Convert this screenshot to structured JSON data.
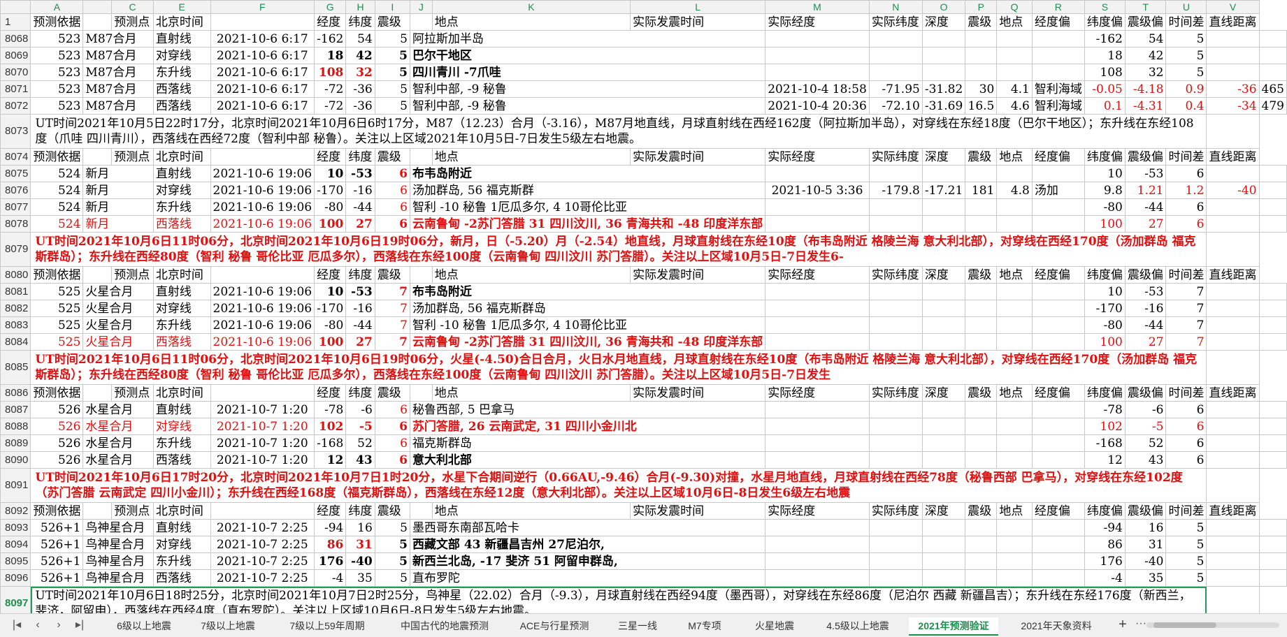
{
  "columns": [
    "",
    "A",
    "",
    "C",
    "E",
    "F",
    "G",
    "H",
    "I",
    "J",
    "K",
    "L",
    "M",
    "N",
    "O",
    "P",
    "Q",
    "R",
    "S",
    "T",
    "U",
    "V"
  ],
  "header_labels": [
    "预测序",
    "预测依据",
    "预测点",
    "北京时间",
    "经度",
    "纬度",
    "震级",
    "地点",
    "实际发震时间",
    "实际经度",
    "实际纬度",
    "深度",
    "震级",
    "地点",
    "经度偏",
    "纬度偏",
    "震级偏",
    "时间差",
    "直线距离"
  ],
  "rows": {
    "r8068": {
      "n": "8068",
      "seq": "523",
      "basis": "M87合月",
      "point": "直射线",
      "time": "2021-10-6 6:17",
      "lon": "-162",
      "lat": "54",
      "mag": "5",
      "place": "阿拉斯加半岛",
      "dlon": "-162",
      "dlat": "54",
      "dmag": "5"
    },
    "r8069": {
      "n": "8069",
      "seq": "523",
      "basis": "M87合月",
      "point": "对穿线",
      "time": "2021-10-6 6:17",
      "lon": "18",
      "lat": "42",
      "mag": "5",
      "place": "巴尔干地区",
      "dlon": "18",
      "dlat": "42",
      "dmag": "5"
    },
    "r8070": {
      "n": "8070",
      "seq": "523",
      "basis": "M87合月",
      "point": "东升线",
      "time": "2021-10-6 6:17",
      "lon": "108",
      "lat": "32",
      "mag": "5",
      "place": "四川青川 -7爪哇",
      "dlon": "108",
      "dlat": "32",
      "dmag": "5"
    },
    "r8071": {
      "n": "8071",
      "seq": "523",
      "basis": "M87合月",
      "point": "西落线",
      "time": "2021-10-6 6:17",
      "lon": "-72",
      "lat": "-36",
      "mag": "5",
      "place": "智利中部, -9 秘鲁",
      "atime": "2021-10-4 18:58",
      "alon": "-71.95",
      "alat": "-31.82",
      "depth": "30",
      "amag": "4.1",
      "aplace": "智利海域",
      "dlon": "-0.05",
      "dlat": "-4.18",
      "dmag": "0.9",
      "dt": "-36",
      "dist": "465"
    },
    "r8072": {
      "n": "8072",
      "seq": "523",
      "basis": "M87合月",
      "point": "西落线",
      "time": "2021-10-6 6:17",
      "lon": "-72",
      "lat": "-36",
      "mag": "5",
      "place": "智利中部, -9 秘鲁",
      "atime": "2021-10-4 20:36",
      "alon": "-72.10",
      "alat": "-31.69",
      "depth": "16.5",
      "amag": "4.6",
      "aplace": "智利海域",
      "dlon": "0.1",
      "dlat": "-4.31",
      "dmag": "0.4",
      "dt": "-34",
      "dist": "479"
    },
    "n8073": {
      "n": "8073",
      "text": "UT时间2021年10月5日22时17分，北京时间2021年10月6日6时17分，M87（12.23）合月（-3.16），M87月地直线，月球直射线在西经162度（阿拉斯加半岛），对穿线在东经18度（巴尔干地区）；东升线在东经108度（爪哇 四川青川），西落线在西经72度（智利中部 秘鲁）。关注以上区域2021年10月5日-7日发生5级左右地震。"
    },
    "h8074": {
      "n": "8074"
    },
    "r8075": {
      "n": "8075",
      "seq": "524",
      "basis": "新月",
      "point": "直射线",
      "time": "2021-10-6 19:06",
      "lon": "10",
      "lat": "-53",
      "mag": "6",
      "place": "布韦岛附近",
      "dlon": "10",
      "dlat": "-53",
      "dmag": "6"
    },
    "r8076": {
      "n": "8076",
      "seq": "524",
      "basis": "新月",
      "point": "对穿线",
      "time": "2021-10-6 19:06",
      "lon": "-170",
      "lat": "-16",
      "mag": "6",
      "place": "汤加群岛, 56 福克斯群",
      "atime": "2021-10-5 3:36",
      "alon": "-179.8",
      "alat": "-17.21",
      "depth": "181",
      "amag": "4.8",
      "aplace": "汤加",
      "dlon": "9.8",
      "dlat": "1.21",
      "dmag": "1.2",
      "dt": "-40"
    },
    "r8077": {
      "n": "8077",
      "seq": "524",
      "basis": "新月",
      "point": "东升线",
      "time": "2021-10-6 19:06",
      "lon": "-80",
      "lat": "-44",
      "mag": "6",
      "place": "智利 -10 秘鲁 1厄瓜多尔, 4 10哥伦比亚",
      "dlon": "-80",
      "dlat": "-44",
      "dmag": "6"
    },
    "r8078": {
      "n": "8078",
      "seq": "524",
      "basis": "新月",
      "point": "西落线",
      "time": "2021-10-6 19:06",
      "lon": "100",
      "lat": "27",
      "mag": "6",
      "place": "云南鲁甸 -2苏门答腊  31 四川汶川,  36 青海共和 -48 印度洋东部",
      "dlon": "100",
      "dlat": "27",
      "dmag": "6"
    },
    "n8079": {
      "n": "8079",
      "text": "UT时间2021年10月6日11时06分，北京时间2021年10月6日19时06分，新月，日（-5.20）月（-2.54）地直线，月球直射线在东经10度（布韦岛附近 格陵兰海 意大利北部），对穿线在西经170度（汤加群岛 福克斯群岛）；东升线在西经80度（智利 秘鲁 哥伦比亚 厄瓜多尔），西落线在东经100度（云南鲁甸 四川汶川 苏门答腊）。关注以上区域10月5日-7日发生6-"
    },
    "h8080": {
      "n": "8080"
    },
    "r8081": {
      "n": "8081",
      "seq": "525",
      "basis": "火星合月",
      "point": "直射线",
      "time": "2021-10-6 19:06",
      "lon": "10",
      "lat": "-53",
      "mag": "7",
      "place": "布韦岛附近",
      "dlon": "10",
      "dlat": "-53",
      "dmag": "7"
    },
    "r8082": {
      "n": "8082",
      "seq": "525",
      "basis": "火星合月",
      "point": "对穿线",
      "time": "2021-10-6 19:06",
      "lon": "-170",
      "lat": "-16",
      "mag": "7",
      "place": "汤加群岛, 56 福克斯群岛",
      "dlon": "-170",
      "dlat": "-16",
      "dmag": "7"
    },
    "r8083": {
      "n": "8083",
      "seq": "525",
      "basis": "火星合月",
      "point": "东升线",
      "time": "2021-10-6 19:06",
      "lon": "-80",
      "lat": "-44",
      "mag": "7",
      "place": "智利 -10 秘鲁 1厄瓜多尔, 4 10哥伦比亚",
      "dlon": "-80",
      "dlat": "-44",
      "dmag": "7"
    },
    "r8084": {
      "n": "8084",
      "seq": "525",
      "basis": "火星合月",
      "point": "西落线",
      "time": "2021-10-6 19:06",
      "lon": "100",
      "lat": "27",
      "mag": "7",
      "place": "云南鲁甸 -2苏门答腊  31 四川汶川,  36 青海共和 -48 印度洋东部",
      "dlon": "100",
      "dlat": "27",
      "dmag": "7"
    },
    "n8085": {
      "n": "8085",
      "text": "UT时间2021年10月6日11时06分，北京时间2021年10月6日19时06分，火星(-4.50)合日合月，火日水月地直线，月球直射线在东经10度（布韦岛附近 格陵兰海 意大利北部），对穿线在西经170度（汤加群岛 福克斯群岛）；东升线在西经80度（智利 秘鲁 哥伦比亚 厄瓜多尔），西落线在东经100度（云南鲁甸 四川汶川 苏门答腊）。关注以上区域10月5日-7日发生"
    },
    "h8086": {
      "n": "8086"
    },
    "r8087": {
      "n": "8087",
      "seq": "526",
      "basis": "水星合月",
      "point": "直射线",
      "time": "2021-10-7 1:20",
      "lon": "-78",
      "lat": "-6",
      "mag": "6",
      "place": "秘鲁西部, 5 巴拿马",
      "dlon": "-78",
      "dlat": "-6",
      "dmag": "6"
    },
    "r8088": {
      "n": "8088",
      "seq": "526",
      "basis": "水星合月",
      "point": "对穿线",
      "time": "2021-10-7 1:20",
      "lon": "102",
      "lat": "-5",
      "mag": "6",
      "place": "苏门答腊, 26 云南武定, 31 四川小金川北",
      "dlon": "102",
      "dlat": "-5",
      "dmag": "6"
    },
    "r8089": {
      "n": "8089",
      "seq": "526",
      "basis": "水星合月",
      "point": "东升线",
      "time": "2021-10-7 1:20",
      "lon": "-168",
      "lat": "52",
      "mag": "6",
      "place": "福克斯群岛",
      "dlon": "-168",
      "dlat": "52",
      "dmag": "6"
    },
    "r8090": {
      "n": "8090",
      "seq": "526",
      "basis": "水星合月",
      "point": "西落线",
      "time": "2021-10-7 1:20",
      "lon": "12",
      "lat": "43",
      "mag": "6",
      "place": "意大利北部",
      "dlon": "12",
      "dlat": "43",
      "dmag": "6"
    },
    "n8091": {
      "n": "8091",
      "text": "UT时间2021年10月6日17时20分，北京时间2021年10月7日1时20分，水星下合期间逆行（0.66AU,-9.46）合月(-9.30)对撞，水星月地直线，月球直射线在西经78度（秘鲁西部 巴拿马），对穿线在东经102度（苏门答腊 云南武定 四川小金川）；东升线在西经168度（福克斯群岛），西落线在东经12度（意大利北部）。关注以上区域10月6日-8日发生6级左右地震"
    },
    "h8092": {
      "n": "8092"
    },
    "r8093": {
      "n": "8093",
      "seq": "526+1",
      "basis": "鸟神星合月",
      "point": "直射线",
      "time": "2021-10-7 2:25",
      "lon": "-94",
      "lat": "16",
      "mag": "5",
      "place": "墨西哥东南部瓦哈卡",
      "dlon": "-94",
      "dlat": "16",
      "dmag": "5"
    },
    "r8094": {
      "n": "8094",
      "seq": "526+1",
      "basis": "鸟神星合月",
      "point": "对穿线",
      "time": "2021-10-7 2:25",
      "lon": "86",
      "lat": "31",
      "mag": "5",
      "place": "西藏文部 43 新疆昌吉州 27尼泊尔,",
      "dlon": "86",
      "dlat": "31",
      "dmag": "5"
    },
    "r8095": {
      "n": "8095",
      "seq": "526+1",
      "basis": "鸟神星合月",
      "point": "东升线",
      "time": "2021-10-7 2:25",
      "lon": "176",
      "lat": "-40",
      "mag": "5",
      "place": "新西兰北岛, -17 斐济 51 阿留申群岛,",
      "dlon": "176",
      "dlat": "-40",
      "dmag": "5"
    },
    "r8096": {
      "n": "8096",
      "seq": "526+1",
      "basis": "鸟神星合月",
      "point": "西落线",
      "time": "2021-10-7 2:25",
      "lon": "-4",
      "lat": "35",
      "mag": "5",
      "place": "直布罗陀",
      "dlon": "-4",
      "dlat": "35",
      "dmag": "5"
    },
    "n8097": {
      "n": "8097",
      "text": "UT时间2021年10月6日18时25分，北京时间2021年10月7日2时25分，鸟神星（22.02）合月（-9.3），月球直射线在西经94度（墨西哥），对穿线在东经86度（尼泊尔 西藏 新疆昌吉）；东升线在东经176度（新西兰，斐济，阿留申），西落线在西经4度（直布罗陀）。关注以上区域10月6日-8日发生5级左右地震。"
    },
    "h8098": {
      "n": "8098"
    }
  },
  "tabs": [
    "6级以上地震",
    "7级以上地震",
    "7级以上59年周期",
    "中国古代的地震预测",
    "ACE与行星预测",
    "三星一线",
    "M7专项",
    "火星地震",
    "4.5级以上地震",
    "2021年预测验证",
    "2021年天象资料"
  ],
  "active_tab": "2021年预测验证",
  "nav_icons": [
    "first-sheet-icon",
    "prev-sheet-icon",
    "next-sheet-icon",
    "last-sheet-icon"
  ]
}
